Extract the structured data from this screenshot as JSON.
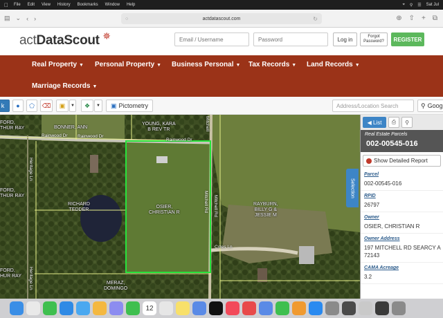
{
  "menubar": {
    "items": [
      "File",
      "Edit",
      "View",
      "History",
      "Bookmarks",
      "Window",
      "Help"
    ],
    "clock": "Sat Jul"
  },
  "browser": {
    "url": "actdatascout.com"
  },
  "site": {
    "logo_text_a": "act",
    "logo_text_b": "DataScout",
    "email_placeholder": "Email / Username",
    "password_placeholder": "Password",
    "login_label": "Log in",
    "forgot_label": "Forgot Password?",
    "register_label": "REGISTER"
  },
  "nav": {
    "items": [
      {
        "label": "Real Property"
      },
      {
        "label": "Personal Property"
      },
      {
        "label": "Business Personal"
      },
      {
        "label": "Tax Records"
      },
      {
        "label": "Land Records"
      },
      {
        "label": "Marriage Records"
      }
    ]
  },
  "map_toolbar": {
    "pictometry_label": "Pictometry",
    "search_placeholder": "Address/Location Search",
    "google_label": "Goog"
  },
  "map": {
    "owners": [
      {
        "text": "BONNER, ANN"
      },
      {
        "text": "YOUNG, KARA\nB REV TR"
      },
      {
        "text": "RICHARD\nTEDDER"
      },
      {
        "text": "OSIER,\nCHRISTIAN R"
      },
      {
        "text": "RAYBURN,\nBILLY G &\nJESSIE M"
      },
      {
        "text": "FORD,\nTHUR RAY"
      },
      {
        "text": "FORD,\nTHUR RAY"
      },
      {
        "text": "MERAZ,\nDOMINGO"
      },
      {
        "text": "FORD,\nHUR RAY"
      }
    ],
    "roads": {
      "rainwood_a": "Rainwood Dr",
      "rainwood_b": "Rainwood Dr",
      "rainwood_c": "Rainwood Dr",
      "heritage_a": "Heritage Ln",
      "heritage_b": "Heritage Ln",
      "mitchell_a": "Mitchell Rd",
      "mitchell_b": "Mitchell Rd",
      "mitchell_top": "Mitchell",
      "coles": "Coles Ln"
    },
    "selection_tab": "Selection"
  },
  "panel": {
    "list_label": "List",
    "subtitle": "Real Estate Parcels",
    "parcel_id": "002-00545-016",
    "detail_button": "Show Detailed Report",
    "fields": [
      {
        "key": "Parcel",
        "value": "002-00545-016"
      },
      {
        "key": "RPID",
        "value": "26797"
      },
      {
        "key": "Owner",
        "value": "OSIER, CHRISTIAN R"
      },
      {
        "key": "Owner Address",
        "value": "197 MITCHELL RD SEARCY A\n72143"
      },
      {
        "key": "CAMA Acreage",
        "value": "3.2"
      }
    ]
  },
  "dock": {
    "calendar_day": "12"
  }
}
